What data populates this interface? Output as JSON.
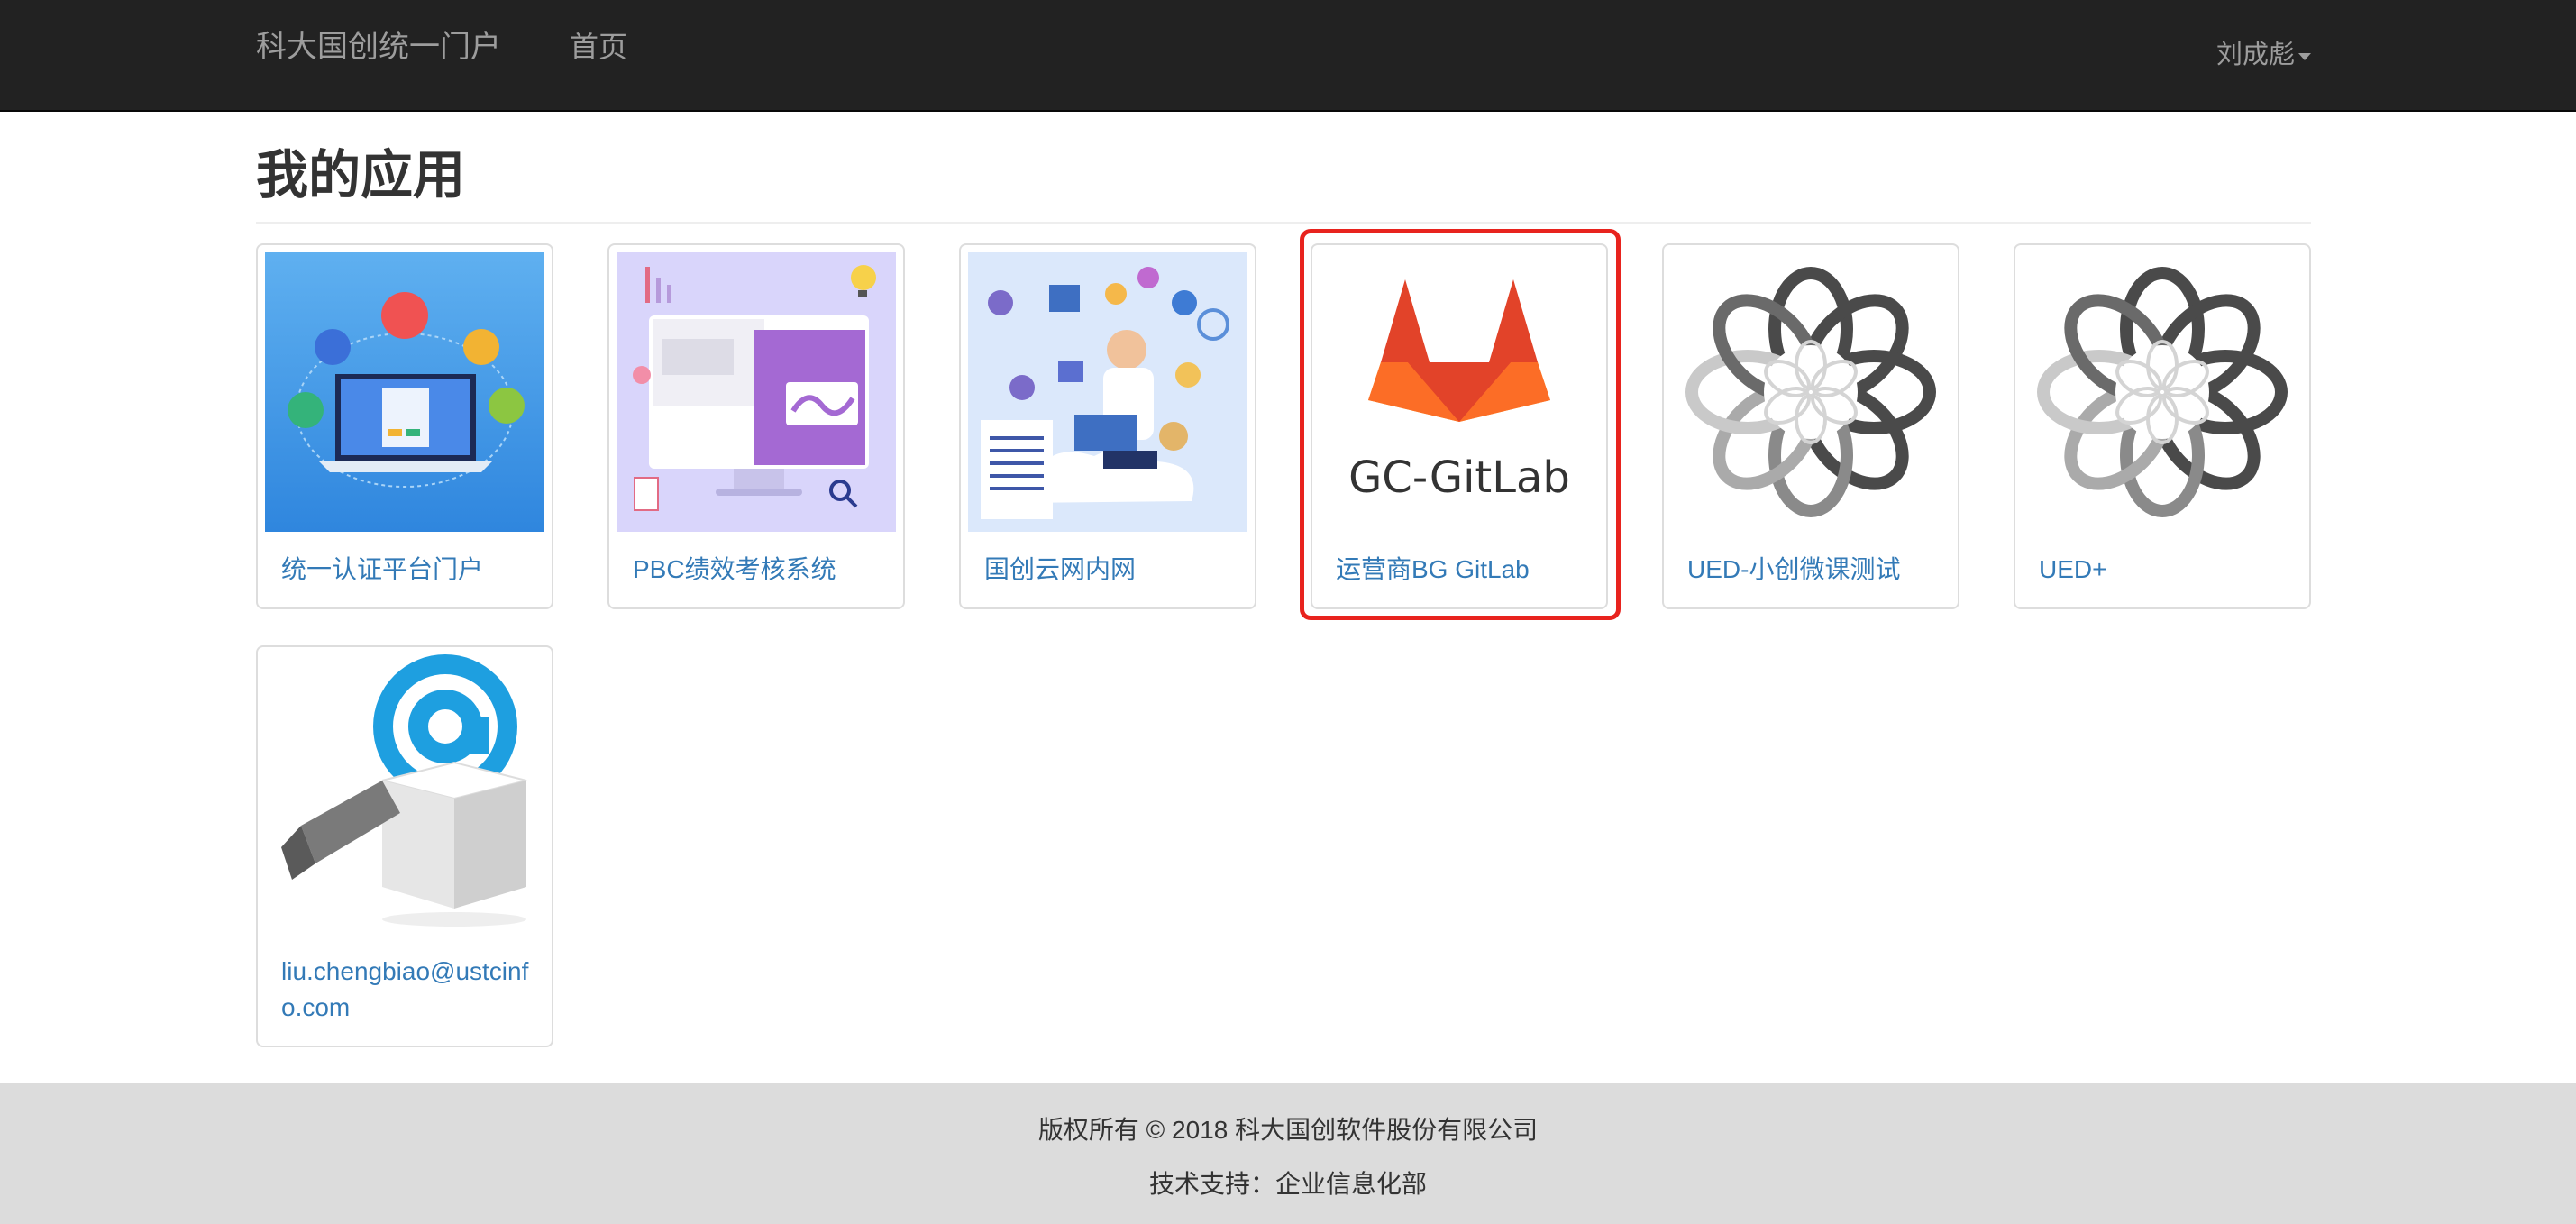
{
  "navbar": {
    "brand": "科大国创统一门户",
    "home": "首页",
    "user": "刘成彪"
  },
  "page": {
    "title": "我的应用"
  },
  "apps": [
    {
      "label": "统一认证平台门户",
      "icon": "laptop-network-illustration"
    },
    {
      "label": "PBC绩效考核系统",
      "icon": "monitor-chart-illustration"
    },
    {
      "label": "国创云网内网",
      "icon": "cloud-worker-illustration"
    },
    {
      "label": "运营商BG GitLab",
      "icon": "gitlab-logo",
      "logo_text": "GC-GitLab"
    },
    {
      "label": "UED-小创微课测试",
      "icon": "flower-logo"
    },
    {
      "label": "UED+",
      "icon": "flower-logo"
    },
    {
      "label": "liu.chengbiao@ustcinfo.com",
      "icon": "mail-box-illustration"
    }
  ],
  "footer": {
    "copyright": "版权所有 © 2018 科大国创软件股份有限公司",
    "support": "技术支持：企业信息化部"
  },
  "colors": {
    "navbar_bg": "#222222",
    "link": "#337ab7",
    "highlight": "#e8231e",
    "footer_bg": "#dcdcdc"
  }
}
